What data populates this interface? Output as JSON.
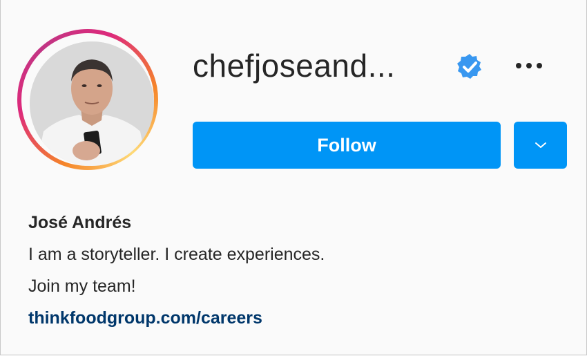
{
  "profile": {
    "username": "chefjoseand...",
    "verified": true,
    "full_name": "José Andrés",
    "bio_lines": [
      "I am a storyteller. I create experiences.",
      "Join my team!"
    ],
    "link": "thinkfoodgroup.com/careers",
    "avatar_alt": "chefjoseandres profile picture"
  },
  "actions": {
    "follow_label": "Follow",
    "more_icon": "more-options-icon",
    "dropdown_icon": "chevron-down-icon"
  },
  "colors": {
    "accent": "#0095f6",
    "link": "#00376b",
    "verified": "#3897f0",
    "text": "#262626",
    "background": "#fafafa"
  }
}
